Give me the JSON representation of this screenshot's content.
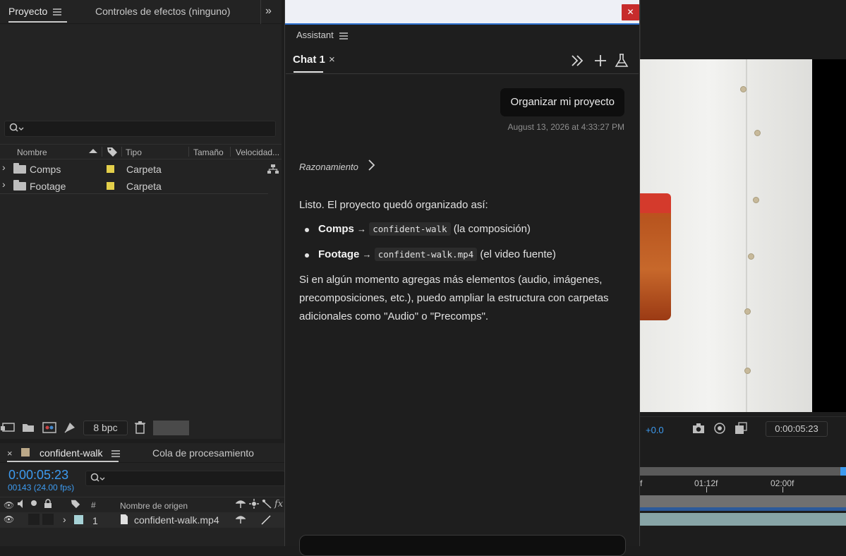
{
  "project": {
    "tab_project": "Proyecto",
    "tab_effects": "Controles de efectos (ninguno)",
    "columns": {
      "name": "Nombre",
      "type": "Tipo",
      "size": "Tamaño",
      "speed": "Velocidad..."
    },
    "rows": [
      {
        "name": "Comps",
        "type": "Carpeta"
      },
      {
        "name": "Footage",
        "type": "Carpeta"
      }
    ],
    "bpc": "8 bpc",
    "label_color": "#e3cf4a"
  },
  "timeline": {
    "comp_tab": "confident-walk",
    "render_tab": "Cola de procesamiento",
    "timecode": "0:00:05:23",
    "frames": "00143 (24.00 fps)",
    "col_hash": "#",
    "col_source": "Nombre de origen",
    "layer": {
      "index": "1",
      "name": "confident-walk.mp4"
    }
  },
  "viewer": {
    "exposure": "+0.0",
    "timecode": "0:00:05:23",
    "ruler": [
      "f",
      "01:12f",
      "02:00f"
    ]
  },
  "assistant": {
    "panel_title": "Assistant",
    "chat_tab": "Chat 1",
    "close_glyph": "×",
    "user_message": "Organizar mi proyecto",
    "timestamp": "August 13, 2026 at 4:33:27 PM",
    "reasoning": "Razonamiento",
    "intro": "Listo. El proyecto quedó organizado así:",
    "items": [
      {
        "folder": "Comps",
        "arrow": "→",
        "file": "confident-walk",
        "desc": "(la composición)"
      },
      {
        "folder": "Footage",
        "arrow": "→",
        "file": "confident-walk.mp4",
        "desc": "(el video fuente)"
      }
    ],
    "outro": "Si en algún momento agregas más elementos (audio, imágenes, precomposiciones, etc.), puedo ampliar la estructura con carpetas adicionales como \"Audio\" o \"Precomps\"."
  },
  "colors": {
    "accent_blue": "#3d9bf0",
    "close_red": "#c72c2c",
    "window_border": "#2d70d0"
  }
}
